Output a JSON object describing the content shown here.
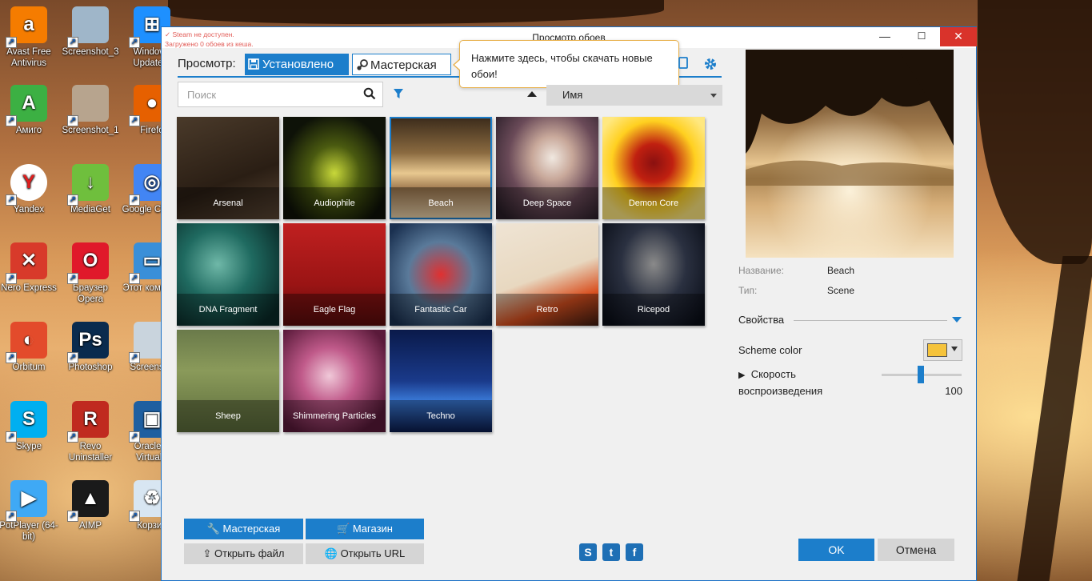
{
  "desktop": {
    "icons": [
      {
        "label": "Avast Free Antivirus",
        "icon": "avast-icon",
        "color": "#f57c00",
        "glyph": "a"
      },
      {
        "label": "Screenshot_3",
        "icon": "screenshot-icon",
        "color": "#9fb6c9",
        "glyph": ""
      },
      {
        "label": "Windows Update A",
        "icon": "windows-icon",
        "color": "#1e90ff",
        "glyph": "⊞"
      },
      {
        "label": "Амиго",
        "icon": "amigo-icon",
        "color": "#3cb043",
        "glyph": "A"
      },
      {
        "label": "Screenshot_1",
        "icon": "screenshot-icon",
        "color": "#b7a48e",
        "glyph": ""
      },
      {
        "label": "Firefo",
        "icon": "firefox-icon",
        "color": "#e66000",
        "glyph": "●"
      },
      {
        "label": "Yandex",
        "icon": "yandex-icon",
        "color": "#ffffff",
        "glyph": "Y"
      },
      {
        "label": "MediaGet",
        "icon": "mediaget-icon",
        "color": "#6fbf3d",
        "glyph": "↓"
      },
      {
        "label": "Google Chrom",
        "icon": "chrome-icon",
        "color": "#4285f4",
        "glyph": "◎"
      },
      {
        "label": "Nero Express",
        "icon": "nero-icon",
        "color": "#d83a2a",
        "glyph": "✕"
      },
      {
        "label": "Браузер Opera",
        "icon": "opera-icon",
        "color": "#e0192a",
        "glyph": "O"
      },
      {
        "label": "Этот компьют",
        "icon": "computer-icon",
        "color": "#3a8fd8",
        "glyph": "▭"
      },
      {
        "label": "Orbitum",
        "icon": "orbitum-icon",
        "color": "#e34b2b",
        "glyph": "◐"
      },
      {
        "label": "Photoshop",
        "icon": "photoshop-icon",
        "color": "#0a2b4e",
        "glyph": "Ps"
      },
      {
        "label": "Screensho",
        "icon": "screenshot-icon",
        "color": "#c9d4dd",
        "glyph": ""
      },
      {
        "label": "Skype",
        "icon": "skype-icon",
        "color": "#00aff0",
        "glyph": "S"
      },
      {
        "label": "Revo Uninstaller",
        "icon": "revo-icon",
        "color": "#c02a1f",
        "glyph": "R"
      },
      {
        "label": "Oracle V VirtualB",
        "icon": "virtualbox-icon",
        "color": "#1f5fa0",
        "glyph": "▣"
      },
      {
        "label": "PotPlayer (64-bit)",
        "icon": "potplayer-icon",
        "color": "#3fa9f5",
        "glyph": "▶"
      },
      {
        "label": "AIMP",
        "icon": "aimp-icon",
        "color": "#1a1a1a",
        "glyph": "▲"
      },
      {
        "label": "Корзин",
        "icon": "recycle-bin-icon",
        "color": "#d8e6f2",
        "glyph": "♻"
      }
    ]
  },
  "window": {
    "title": "Просмотр обоев",
    "steam_warning_line1": "Steam не доступен.",
    "steam_warning_line2": "Загружено 0 обоев из кеша.",
    "minimize": "—",
    "maximize": "☐",
    "close": "✕"
  },
  "tabs": {
    "label": "Просмотр:",
    "installed": "Установлено",
    "workshop": "Мастерская"
  },
  "tooltip": {
    "text": "Нажмите здесь, чтобы скачать новые обои!"
  },
  "search": {
    "placeholder": "Поиск"
  },
  "sort": {
    "selected": "Имя"
  },
  "wallpapers": [
    {
      "name": "Arsenal",
      "bg": "linear-gradient(160deg,#4a3a2a,#2a1e14 60%,#5a4634)"
    },
    {
      "name": "Audiophile",
      "bg": "radial-gradient(ellipse at 50% 55%,#c8d83a 0%,#4a5a10 35%,#0e1208 75%)"
    },
    {
      "name": "Beach",
      "bg": "linear-gradient(180deg,#3a2a1a 0%,#8a6a40 35%,#e8c890 55%,#a07a50 70%,#f0d8b0 100%)",
      "selected": true
    },
    {
      "name": "Deep Space",
      "bg": "radial-gradient(ellipse at 55% 40%,#f0e8e0 0%,#c8a89a 25%,#6a4a58 55%,#2a1e28 90%)"
    },
    {
      "name": "Demon Core",
      "bg": "radial-gradient(circle at 50% 45%,#8a1010 0%,#c02010 25%,#ffd020 55%,#ffe880 80%)"
    },
    {
      "name": "DNA Fragment",
      "bg": "radial-gradient(ellipse at 40% 40%,#6fb8a8 0%,#1f6a60 40%,#0a2a28 85%)"
    },
    {
      "name": "Eagle Flag",
      "bg": "linear-gradient(180deg,#c02020 0%,#9a1414 60%,#5a0c0c 100%)"
    },
    {
      "name": "Fantastic Car",
      "bg": "radial-gradient(ellipse at 50% 50%,#e03030 0%,#5a7a9a 45%,#1a3050 90%)"
    },
    {
      "name": "Retro",
      "bg": "linear-gradient(160deg,#efe4d4 0%,#e8d8c0 50%,#d85020 75%,#3a1a10 100%)"
    },
    {
      "name": "Ricepod",
      "bg": "radial-gradient(ellipse at 50% 40%,#8a8a8a 0%,#2a3040 45%,#0a0e18 90%)"
    },
    {
      "name": "Sheep",
      "bg": "linear-gradient(180deg,#6a7a4a 0%,#8a9a5a 40%,#5a6a3a 100%)"
    },
    {
      "name": "Shimmering Particles",
      "bg": "radial-gradient(circle at 45% 45%,#f0c8d8 0%,#c05a8a 35%,#5a1a3a 80%)"
    },
    {
      "name": "Techno",
      "bg": "linear-gradient(180deg,#0a1a4a 0%,#1a3a8a 50%,#3a7ad8 70%,#0a1a4a 100%)"
    }
  ],
  "actions": {
    "workshop": "Мастерская",
    "shop": "Магазин",
    "open_file": "Открыть файл",
    "open_url": "Открыть URL"
  },
  "social": [
    "steam-icon",
    "twitter-icon",
    "facebook-icon"
  ],
  "details": {
    "name_label": "Название:",
    "name_value": "Beach",
    "type_label": "Тип:",
    "type_value": "Scene",
    "properties": "Свойства",
    "scheme_color_label": "Scheme color",
    "scheme_color": "#f5c33b",
    "speed_label_1": "Скорость",
    "speed_label_2": "воспроизведения",
    "speed_value": "100"
  },
  "footer": {
    "ok": "OK",
    "cancel": "Отмена"
  }
}
